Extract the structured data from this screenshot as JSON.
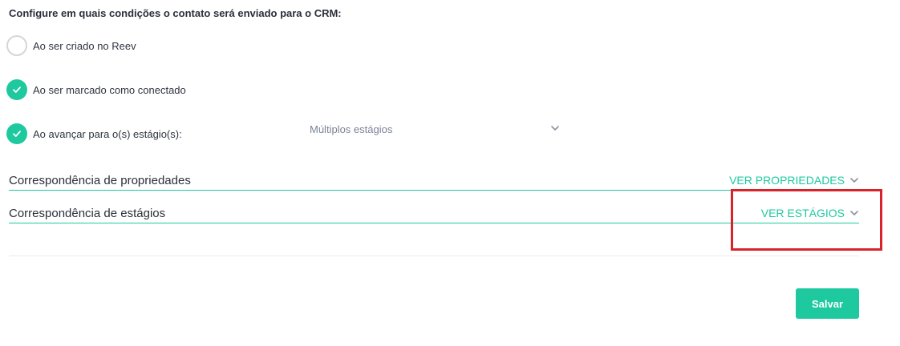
{
  "heading": "Configure em quais condições o contato será enviado para o CRM:",
  "options": [
    {
      "label": "Ao ser criado no Reev",
      "checked": false
    },
    {
      "label": "Ao ser marcado como conectado",
      "checked": true
    },
    {
      "label": "Ao avançar para o(s) estágio(s):",
      "checked": true
    }
  ],
  "stage_select": {
    "value": "Múltiplos estágios",
    "icon": "chevron-down-icon"
  },
  "sections": {
    "properties": {
      "label": "Correspondência de propriedades",
      "action": "VER PROPRIEDADES",
      "icon": "chevron-down-icon"
    },
    "stages": {
      "label": "Correspondência de estágios",
      "action": "VER ESTÁGIOS",
      "icon": "chevron-down-icon"
    }
  },
  "save_button": {
    "label": "Salvar"
  },
  "colors": {
    "accent": "#1ec9a0",
    "highlight": "#d9232b",
    "radio_off_border": "#d6d6d6"
  }
}
